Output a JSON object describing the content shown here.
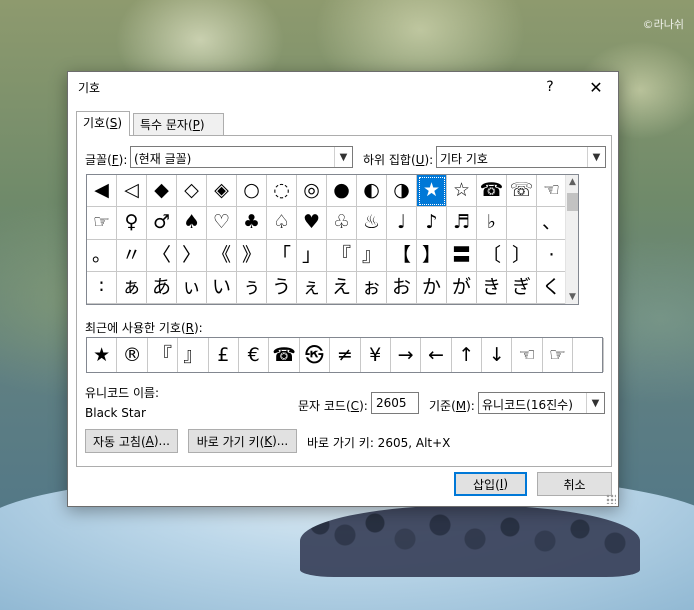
{
  "watermark": "©라나쉬",
  "window": {
    "title": "기호",
    "help_label": "?",
    "close_label": "✕"
  },
  "tabs": [
    {
      "label": "기호(",
      "key": "S",
      "suffix": ")"
    },
    {
      "label": "특수 문자(",
      "key": "P",
      "suffix": ")"
    }
  ],
  "font": {
    "label": "글꼴(",
    "key": "F",
    "suffix": "):",
    "value": "(현재 글꼴)"
  },
  "subset": {
    "label": "하위 집합(",
    "key": "U",
    "suffix": "):",
    "value": "기타 기호"
  },
  "symbols": [
    "◀",
    "◁",
    "◆",
    "◇",
    "◈",
    "○",
    "◌",
    "◎",
    "●",
    "◐",
    "◑",
    "★",
    "☆",
    "☎",
    "☏",
    "☜",
    "☞",
    "♀",
    "♂",
    "♠",
    "♡",
    "♣",
    "♤",
    "♥",
    "♧",
    "♨",
    "♩",
    "♪",
    "♬",
    "♭",
    "",
    "、",
    "。",
    "〃",
    "〈",
    "〉",
    "《",
    "》",
    "「",
    "」",
    "『",
    "』",
    "【",
    "】",
    "〓",
    "〔",
    "〕",
    "·",
    "∶",
    "ぁ",
    "あ",
    "ぃ",
    "い",
    "ぅ",
    "う",
    "ぇ",
    "え",
    "ぉ",
    "お",
    "か",
    "が",
    "き",
    "ぎ",
    "く"
  ],
  "selected_symbol_index": 11,
  "recent": {
    "label": "최근에 사용한 기호(",
    "key": "R",
    "suffix": "):",
    "symbols": [
      "★",
      "®",
      "『",
      "』",
      "£",
      "€",
      "☎",
      "㉿",
      "≠",
      "¥",
      "→",
      "←",
      "↑",
      "↓",
      "☜",
      "☞",
      ""
    ]
  },
  "unicode_name": {
    "label": "유니코드 이름:",
    "value": "Black Star"
  },
  "char_code": {
    "label": "문자 코드(",
    "key": "C",
    "suffix": "):",
    "value": "2605"
  },
  "from": {
    "label": "기준(",
    "key": "M",
    "suffix": "):",
    "value": "유니코드(16진수)"
  },
  "buttons": {
    "autocorrect": {
      "label": "자동 고침(",
      "key": "A",
      "suffix": ")..."
    },
    "shortcut_key": {
      "label": "바로 가기 키(",
      "key": "K",
      "suffix": ")..."
    },
    "insert": {
      "label": "삽입(",
      "key": "I",
      "suffix": ")"
    },
    "cancel": "취소"
  },
  "shortcut_text": "바로 가기 키: 2605, Alt+X"
}
